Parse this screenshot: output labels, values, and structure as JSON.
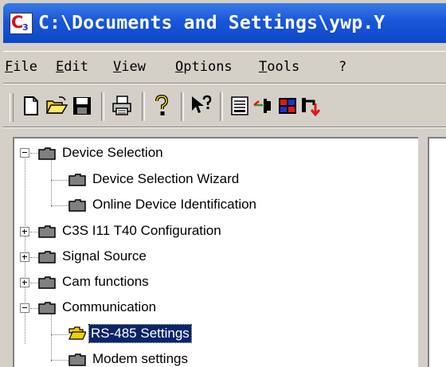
{
  "window": {
    "title": "C:\\Documents and Settings\\ywp.Y",
    "app_icon_letter": "C",
    "app_icon_number": "3"
  },
  "menu": {
    "items": [
      "File",
      "Edit",
      "View",
      "Options",
      "Tools",
      "?"
    ]
  },
  "toolbar": {
    "buttons": [
      "new-icon",
      "open-icon",
      "save-icon",
      "print-icon",
      "help-icon",
      "context-help-icon",
      "terminal-icon",
      "connect-icon",
      "device-icon",
      "transfer-icon"
    ]
  },
  "tree": {
    "nodes": [
      {
        "label": "Device Selection",
        "expander": "minus",
        "level": 0
      },
      {
        "label": "Device Selection Wizard",
        "level": 1
      },
      {
        "label": "Online Device Identification",
        "level": 1
      },
      {
        "label": "C3S I11 T40 Configuration",
        "expander": "plus",
        "level": 0
      },
      {
        "label": "Signal Source",
        "expander": "plus",
        "level": 0
      },
      {
        "label": "Cam functions",
        "expander": "plus",
        "level": 0
      },
      {
        "label": "Communication",
        "expander": "minus",
        "level": 0
      },
      {
        "label": "RS-485 Settings",
        "level": 1,
        "selected": true,
        "open_folder": true
      },
      {
        "label": "Modem settings",
        "level": 1
      }
    ]
  },
  "colors": {
    "titlebar": "#1956d9",
    "selection": "#0a246a",
    "folder_fill": "#808080",
    "open_folder_fill": "#f0d000"
  }
}
